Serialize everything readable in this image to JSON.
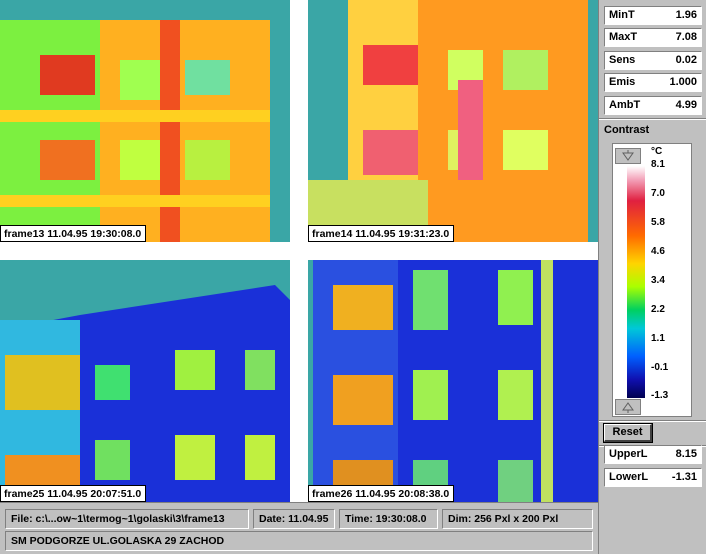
{
  "frames": [
    {
      "label": "frame13  11.04.95 19:30:08.0"
    },
    {
      "label": "frame14  11.04.95 19:31:23.0"
    },
    {
      "label": "frame25  11.04.95 20:07:51.0"
    },
    {
      "label": "frame26  11.04.95 20:08:38.0"
    }
  ],
  "params": [
    {
      "key": "MinT",
      "value": "1.96"
    },
    {
      "key": "MaxT",
      "value": "7.08"
    },
    {
      "key": "Sens",
      "value": "0.02"
    },
    {
      "key": "Emis",
      "value": "1.000"
    },
    {
      "key": "AmbT",
      "value": "4.99"
    }
  ],
  "contrast": {
    "title": "Contrast",
    "unit": "°C",
    "ticks": [
      "8.1",
      "7.0",
      "5.8",
      "4.6",
      "3.4",
      "2.2",
      "1.1",
      "-0.1",
      "-1.3"
    ],
    "up_icon": "arrow-down-icon",
    "down_icon": "arrow-up-icon"
  },
  "reset_label": "Reset",
  "limits": [
    {
      "key": "UpperL",
      "value": "8.15"
    },
    {
      "key": "LowerL",
      "value": "-1.31"
    }
  ],
  "status": {
    "file": "File: c:\\...ow~1\\termog~1\\golaski\\3\\frame13",
    "date": "Date: 11.04.95",
    "time": "Time: 19:30:08.0",
    "dim": "Dim: 256 Pxl x 200 Pxl",
    "caption": "SM PODGORZE UL.GOLASKA 29 ZACHOD"
  },
  "colors": {
    "background_teal": "#3aa6a6",
    "warm": "#ff8c00",
    "hot": "#e02040",
    "cold": "#1a2ad0"
  }
}
